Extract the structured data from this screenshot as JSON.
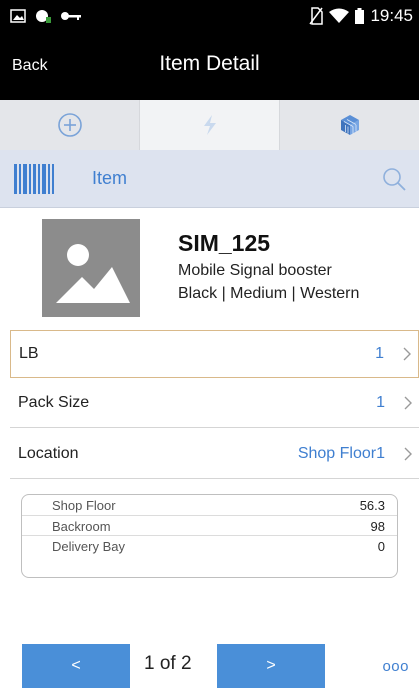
{
  "status_bar": {
    "time": "19:45",
    "icons": [
      "image-icon",
      "android-debug-icon",
      "key-icon",
      "no-sim-icon",
      "wifi-icon",
      "battery-icon"
    ]
  },
  "header": {
    "back_label": "Back",
    "title": "Item Detail"
  },
  "tabs": [
    {
      "icon": "add-circle-icon",
      "active": false
    },
    {
      "icon": "lightning-icon",
      "active": true
    },
    {
      "icon": "cube-icon",
      "active": false
    }
  ],
  "item_bar": {
    "label": "Item"
  },
  "item": {
    "sku": "SIM_125",
    "description": "Mobile Signal booster",
    "attributes": "Black | Medium | Western"
  },
  "details": [
    {
      "label": "LB",
      "value": "1"
    },
    {
      "label": "Pack Size",
      "value": "1"
    },
    {
      "label": "Location",
      "value": "Shop Floor1"
    }
  ],
  "locations": [
    {
      "name": "Shop Floor",
      "qty": "56.3"
    },
    {
      "name": "Backroom",
      "qty": "98"
    },
    {
      "name": "Delivery Bay",
      "qty": "0"
    }
  ],
  "footer": {
    "prev_label": "<",
    "next_label": ">",
    "page_indicator": "1 of 2",
    "more_label": "ooo"
  },
  "colors": {
    "accent": "#3f7fd0",
    "button": "#4a8fd8",
    "header_bg": "#000000",
    "item_bar_bg": "#dde3ef"
  }
}
